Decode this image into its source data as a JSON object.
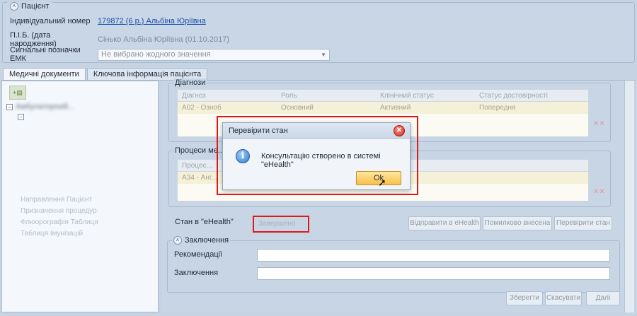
{
  "patient": {
    "section_title": "Пацієнт",
    "id_label": "Індивідуальний номер",
    "id_value": "179872 (6 р.) Альбіна Юріївна",
    "name_label": "П.І.Б. (дата народження)",
    "name_value": "Сінько Альбіна Юріївна (01.10.2017)",
    "emk_label": "Сигнальні позначки ЕМК",
    "emk_placeholder": "Не вибрано жодного значення"
  },
  "tabs": [
    {
      "label": "Медичні документи",
      "active": true
    },
    {
      "label": "Ключова інформація пацієнта",
      "active": false
    }
  ],
  "tree": {
    "root_label": "Амбулаторний...",
    "side_links": [
      "Направлення Пацієнт",
      "Призначення процедур",
      "Флюорографія Таблиця",
      "Таблиця Імунізацій"
    ]
  },
  "diagnoses": {
    "title": "Діагнози",
    "columns": [
      "Діагноз",
      "Роль",
      "Клінічний статус",
      "Статус достовірності"
    ],
    "rows": [
      [
        "A02 - Озноб",
        "Основний",
        "Активний",
        "Попередня"
      ]
    ]
  },
  "processes": {
    "title": "Процеси ме...",
    "columns": [
      "Процес..."
    ],
    "rows": [
      [
        "A34 - Анг..."
      ]
    ]
  },
  "ehealth": {
    "status_label": "Стан в \"eHealth\"",
    "status_value": "Завершено",
    "buttons": [
      "Відправити в eHealth",
      "Помилково внесена",
      "Перевірити стан"
    ]
  },
  "conclusion": {
    "section_title": "Заключення",
    "recommendations_label": "Рекомендації",
    "conclusion_label": "Заключення"
  },
  "footer_buttons": [
    "Зберегти",
    "Скасувати",
    "Далі"
  ],
  "dialog": {
    "title": "Перевірити стан",
    "message": "Консультацію створено в системі \"eHealth\"",
    "ok_label": "Ok",
    "close_icon": "close-icon",
    "info_icon": "info-icon"
  },
  "colors": {
    "highlight": "#e01818",
    "background": "#c5d3e3",
    "ok_button": "#f6c04a"
  }
}
